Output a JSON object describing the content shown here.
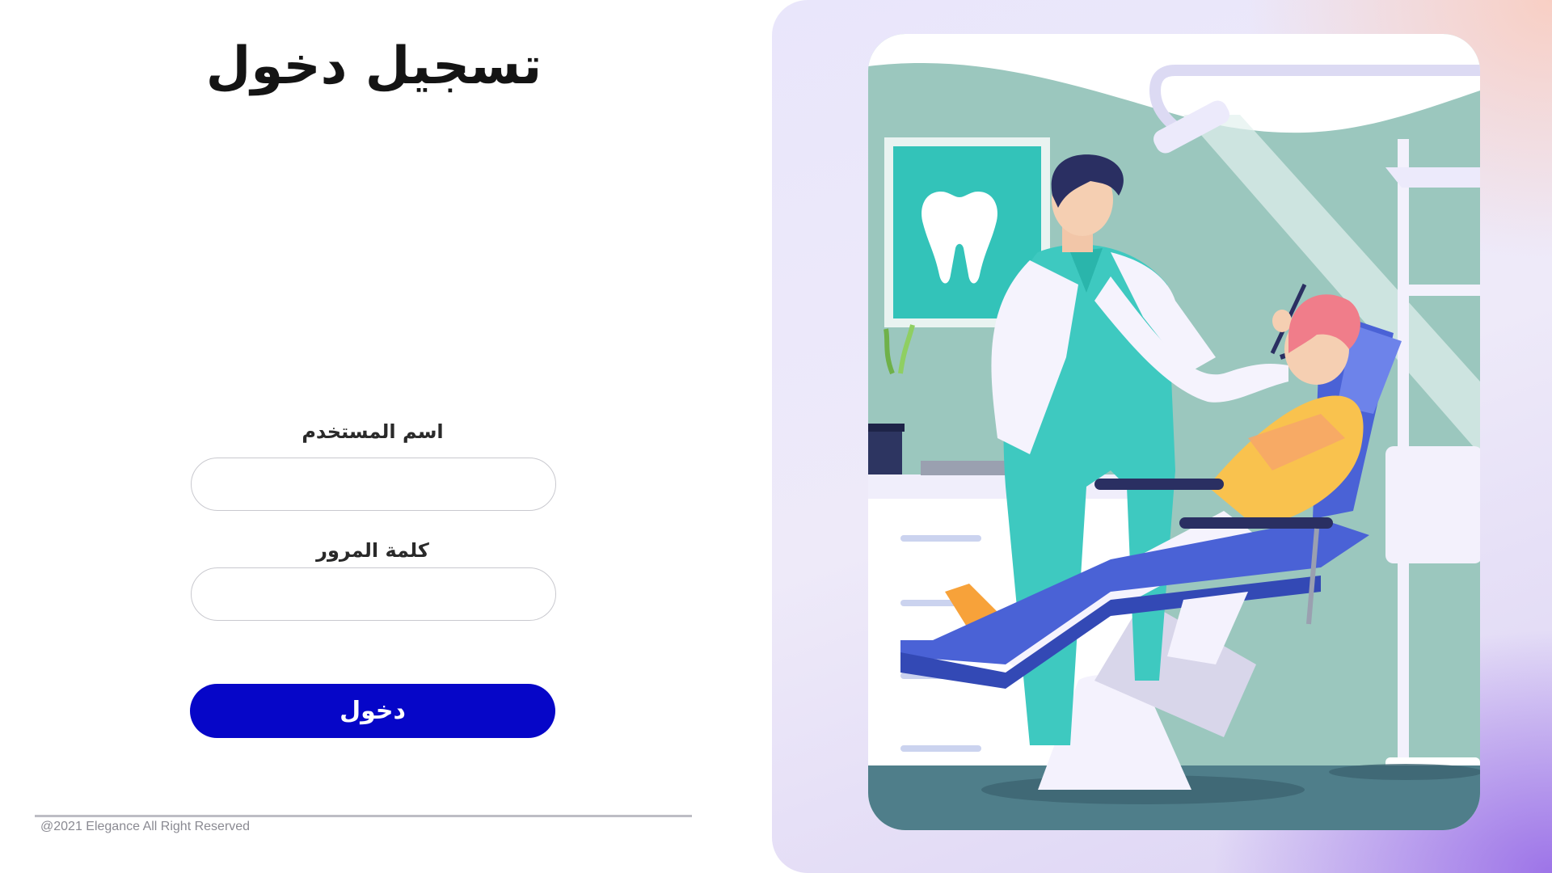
{
  "login": {
    "title": "تسجيل دخول",
    "username_label": "اسم المستخدم",
    "username_value": "",
    "password_label": "كلمة المرور",
    "password_value": "",
    "submit_label": "دخول"
  },
  "footer": {
    "copyright": "@2021 Elegance All Right Reserved"
  },
  "colors": {
    "accent": "#0606c8",
    "wall": "#9bc7be",
    "chair": "#4a62d6"
  },
  "icons": {
    "tooth": "tooth-icon"
  }
}
